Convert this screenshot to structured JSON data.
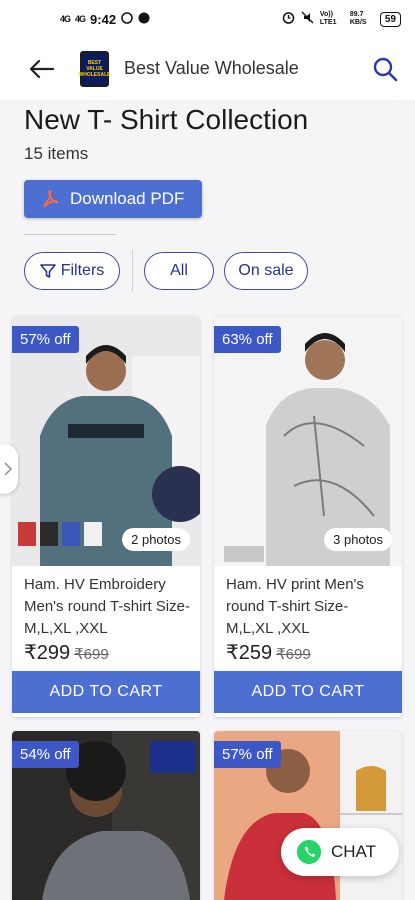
{
  "status": {
    "time": "9:42",
    "signal_1": "4G",
    "signal_2": "4G",
    "network": "Vo)) LTE1",
    "speed": "89.7 KB/S",
    "battery": "59"
  },
  "header": {
    "store_name": "Best Value Wholesale",
    "logo_text": [
      "BEST",
      "VALUE",
      "WHOLESALE"
    ]
  },
  "collection": {
    "title": "New T- Shirt Collection",
    "count": "15 items",
    "download_label": "Download PDF"
  },
  "filters": {
    "filters_label": "Filters",
    "all_label": "All",
    "sale_label": "On sale"
  },
  "products": [
    {
      "discount": "57% off",
      "photos": "2 photos",
      "title": "Ham. HV Embroidery Men's round T-shirt Size- M,L,XL ,XXL",
      "price": "₹299",
      "mrp": "₹699",
      "cta": "ADD TO CART"
    },
    {
      "discount": "63% off",
      "photos": "3 photos",
      "title": "Ham. HV print Men's round T-shirt Size- M,L,XL ,XXL",
      "price": "₹259",
      "mrp": "₹699",
      "cta": "ADD TO CART"
    },
    {
      "discount": "54% off"
    },
    {
      "discount": "57% off"
    }
  ],
  "chat_label": "CHAT",
  "colors": {
    "primary": "#4d6fd1",
    "badge": "#3e57c6",
    "chip_border": "#3e4a9e",
    "whatsapp": "#25d366"
  },
  "icons": [
    "back-arrow-icon",
    "search-icon",
    "pdf-icon",
    "filter-icon",
    "chevron-right-icon",
    "whatsapp-icon"
  ]
}
